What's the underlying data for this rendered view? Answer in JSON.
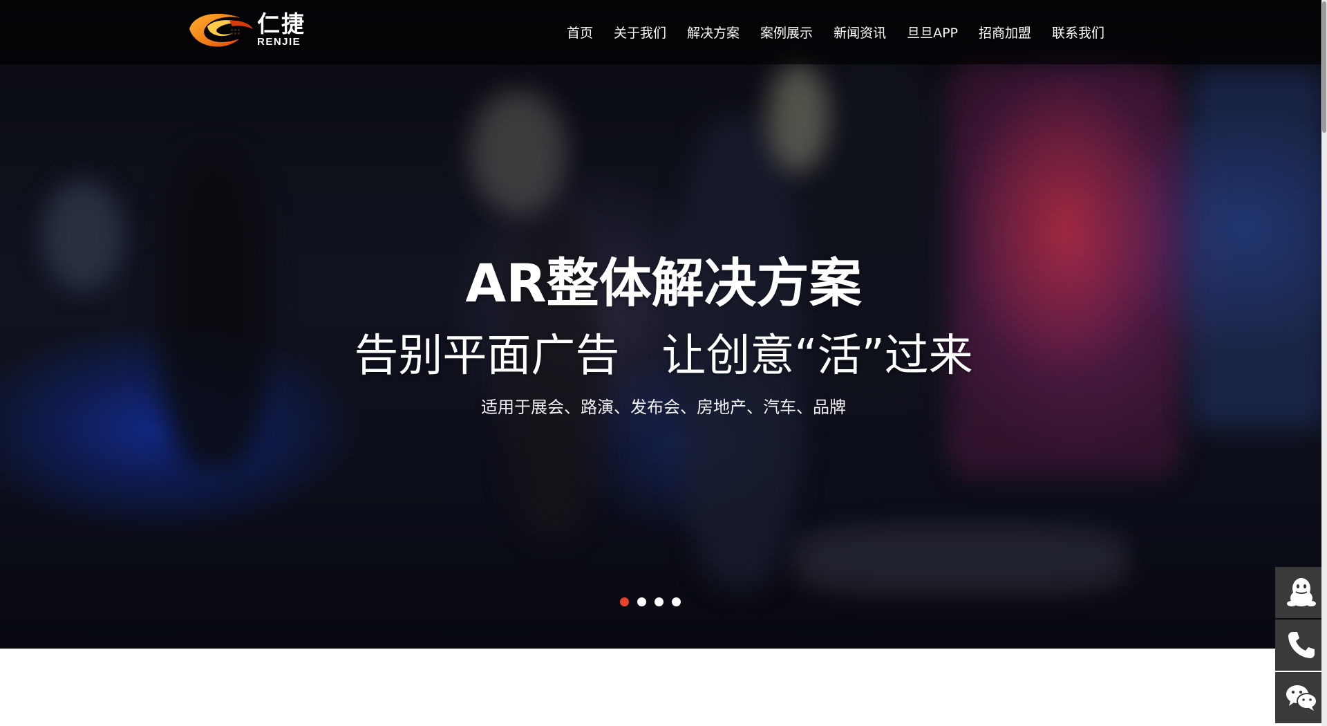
{
  "brand": {
    "name_cn": "仁捷",
    "name_en": "RENJIE"
  },
  "nav": {
    "items": [
      {
        "label": "首页"
      },
      {
        "label": "关于我们"
      },
      {
        "label": "解决方案"
      },
      {
        "label": "案例展示"
      },
      {
        "label": "新闻资讯"
      },
      {
        "label": "旦旦APP"
      },
      {
        "label": "招商加盟"
      },
      {
        "label": "联系我们"
      }
    ]
  },
  "hero": {
    "title": "AR整体解决方案",
    "subtitle": "告别平面广告   让创意“活”过来",
    "description": "适用于展会、路演、发布会、房地产、汽车、品牌",
    "slides_total": 4,
    "active_slide": 1
  },
  "contact": {
    "icons": [
      "qq-icon",
      "phone-icon",
      "wechat-icon"
    ]
  },
  "colors": {
    "accent": "#e8432b",
    "logo_orange": "#f08a1c",
    "contact_bg": "#3a3a3a"
  }
}
